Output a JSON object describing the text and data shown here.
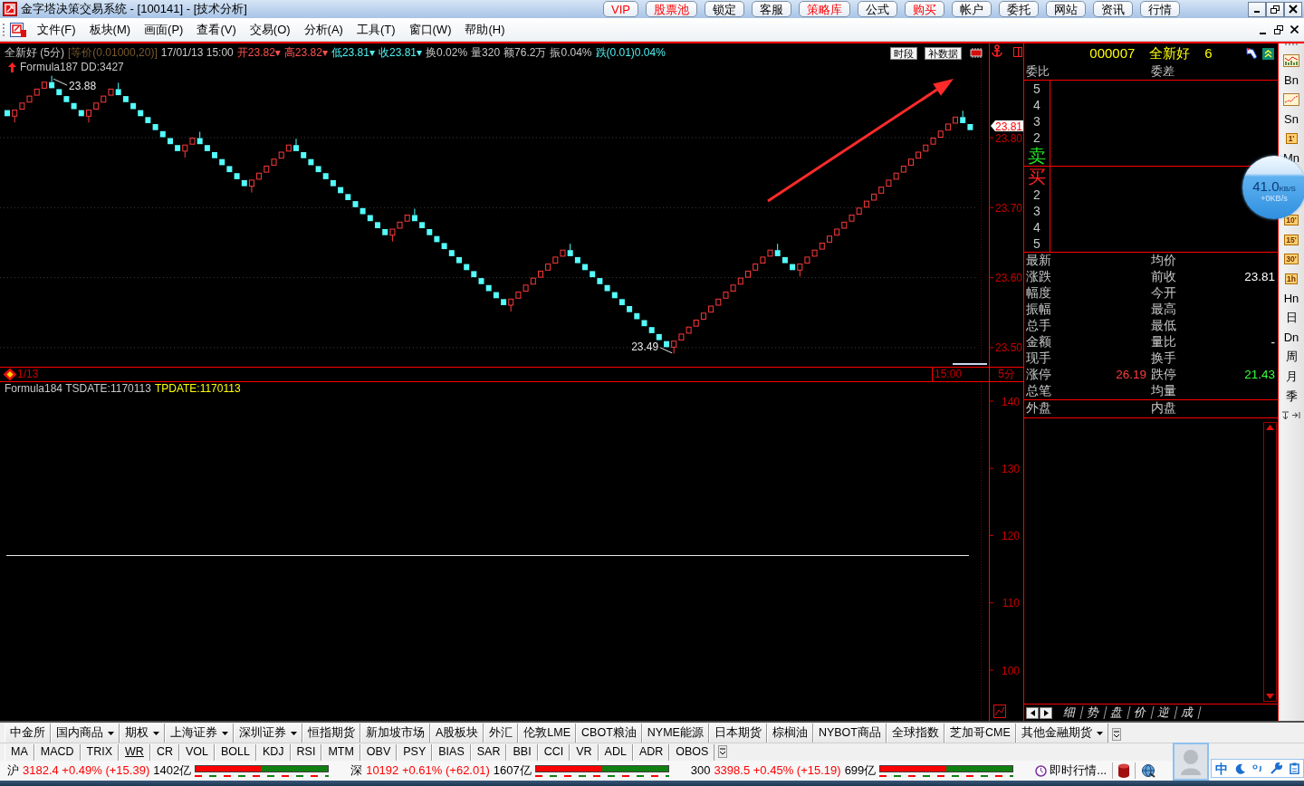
{
  "window": {
    "title": "金字塔决策交易系统 - [100141] - [技术分析]",
    "quick_buttons": [
      {
        "label": "VIP",
        "highlighted": true
      },
      {
        "label": "股票池",
        "highlighted": true
      },
      {
        "label": "锁定",
        "highlighted": false
      },
      {
        "label": "客服",
        "highlighted": false
      },
      {
        "label": "策略库",
        "highlighted": true
      },
      {
        "label": "公式",
        "highlighted": false
      },
      {
        "label": "购买",
        "highlighted": true
      },
      {
        "label": "帐户",
        "highlighted": false
      },
      {
        "label": "委托",
        "highlighted": false
      },
      {
        "label": "网站",
        "highlighted": false
      },
      {
        "label": "资讯",
        "highlighted": false
      },
      {
        "label": "行情",
        "highlighted": false
      }
    ]
  },
  "menu": [
    "文件(F)",
    "板块(M)",
    "画面(P)",
    "查看(V)",
    "交易(O)",
    "分析(A)",
    "工具(T)",
    "窗口(W)",
    "帮助(H)"
  ],
  "chart": {
    "header": [
      {
        "text": "全新好 (5分)",
        "color": "#c8c8c8"
      },
      {
        "text": "[等价(0.01000,20)]",
        "color": "#7a5a30"
      },
      {
        "text": "17/01/13 15:00",
        "color": "#c8c8c8"
      },
      {
        "text": "开23.82▾",
        "color": "#ff5050"
      },
      {
        "text": "高23.82▾",
        "color": "#ff5050"
      },
      {
        "text": "低23.81▾",
        "color": "#50f0f0"
      },
      {
        "text": "收23.81▾",
        "color": "#50f0f0"
      },
      {
        "text": "换0.02%",
        "color": "#c8c8c8"
      },
      {
        "text": "量320",
        "color": "#c8c8c8"
      },
      {
        "text": "额76.2万",
        "color": "#c8c8c8"
      },
      {
        "text": "振0.04%",
        "color": "#c8c8c8"
      },
      {
        "text": "跌(0.01)0.04%",
        "color": "#50f0f0"
      }
    ],
    "buttons": [
      "时段",
      "补数据"
    ],
    "formula": "Formula187 DD:3427",
    "high_label": "23.88",
    "low_label": "23.49",
    "last_price": "23.81",
    "yticks": [
      "23.80",
      "23.70",
      "23.60",
      "23.50"
    ],
    "date_label": "1/13",
    "time_label": "15:00",
    "period": "5分"
  },
  "indicator": {
    "formula": [
      {
        "text": "Formula184 TSDATE:1170113",
        "color": "#c8c8c8"
      },
      {
        "text": "TPDATE:1170113",
        "color": "#ffff00"
      }
    ],
    "yticks": [
      "140",
      "130",
      "120",
      "110",
      "100"
    ]
  },
  "quote": {
    "title": [
      "000007",
      "全新好",
      "6"
    ],
    "order_header": [
      "委比",
      "委差"
    ],
    "sell_levels": [
      "5",
      "4",
      "3",
      "2"
    ],
    "sell_label": "卖",
    "buy_label": "买",
    "buy_levels": [
      "2",
      "3",
      "4",
      "5"
    ],
    "stats": [
      [
        {
          "label": "最新"
        },
        {
          "label": "均价"
        }
      ],
      [
        {
          "label": "涨跌"
        },
        {
          "label": "前收",
          "value": "23.81"
        }
      ],
      [
        {
          "label": "幅度"
        },
        {
          "label": "今开"
        }
      ],
      [
        {
          "label": "振幅"
        },
        {
          "label": "最高"
        }
      ],
      [
        {
          "label": "总手"
        },
        {
          "label": "最低"
        }
      ],
      [
        {
          "label": "金额"
        },
        {
          "label": "量比",
          "value": "-"
        }
      ],
      [
        {
          "label": "现手"
        },
        {
          "label": "换手"
        }
      ],
      [
        {
          "label": "涨停",
          "value": "26.19",
          "color": "#ff3c3c"
        },
        {
          "label": "跌停",
          "value": "21.43",
          "color": "#3cff3c"
        }
      ],
      [
        {
          "label": "总笔"
        },
        {
          "label": "均量"
        }
      ]
    ],
    "trade_side": [
      "外盘",
      "内盘"
    ],
    "tabs": [
      "细",
      "势",
      "盘",
      "价",
      "逆",
      "成"
    ]
  },
  "period_bar": {
    "upper": [
      {
        "kind": "barchart"
      },
      {
        "kind": "text",
        "label": "Bn"
      },
      {
        "kind": "linechart"
      },
      {
        "kind": "text",
        "label": "Sn"
      },
      {
        "kind": "tile",
        "label": "1'"
      },
      {
        "kind": "text",
        "label": "Mn"
      }
    ],
    "lower": [
      {
        "kind": "tile",
        "label": "10'"
      },
      {
        "kind": "tile",
        "label": "15'"
      },
      {
        "kind": "tile",
        "label": "30'"
      },
      {
        "kind": "tile",
        "label": "1h"
      },
      {
        "kind": "text",
        "label": "Hn"
      },
      {
        "kind": "text",
        "label": "日"
      },
      {
        "kind": "text",
        "label": "Dn"
      },
      {
        "kind": "text",
        "label": "周"
      },
      {
        "kind": "text",
        "label": "月"
      },
      {
        "kind": "text",
        "label": "季"
      }
    ]
  },
  "speed_meter": {
    "value": "41.0",
    "unit": "KB/S",
    "delta": "+0KB/s"
  },
  "market_tabs": [
    {
      "label": "中金所",
      "dropdown": false
    },
    {
      "label": "国内商品",
      "dropdown": true
    },
    {
      "label": "期权",
      "dropdown": true
    },
    {
      "label": "上海证券",
      "dropdown": true
    },
    {
      "label": "深圳证券",
      "dropdown": true
    },
    {
      "label": "恒指期货",
      "dropdown": false
    },
    {
      "label": "新加坡市场",
      "dropdown": false
    },
    {
      "label": "A股板块",
      "dropdown": false
    },
    {
      "label": "外汇",
      "dropdown": false
    },
    {
      "label": "伦敦LME",
      "dropdown": false
    },
    {
      "label": "CBOT粮油",
      "dropdown": false
    },
    {
      "label": "NYME能源",
      "dropdown": false
    },
    {
      "label": "日本期货",
      "dropdown": false
    },
    {
      "label": "棕榈油",
      "dropdown": false
    },
    {
      "label": "NYBOT商品",
      "dropdown": false
    },
    {
      "label": "全球指数",
      "dropdown": false
    },
    {
      "label": "芝加哥CME",
      "dropdown": false
    },
    {
      "label": "其他金融期货",
      "dropdown": true
    }
  ],
  "indicator_tabs": [
    {
      "label": "MA",
      "selected": false
    },
    {
      "label": "MACD",
      "selected": false
    },
    {
      "label": "TRIX",
      "selected": false
    },
    {
      "label": "WR",
      "selected": true
    },
    {
      "label": "CR",
      "selected": false
    },
    {
      "label": "VOL",
      "selected": false
    },
    {
      "label": "BOLL",
      "selected": false
    },
    {
      "label": "KDJ",
      "selected": false
    },
    {
      "label": "RSI",
      "selected": false
    },
    {
      "label": "MTM",
      "selected": false
    },
    {
      "label": "OBV",
      "selected": false
    },
    {
      "label": "PSY",
      "selected": false
    },
    {
      "label": "BIAS",
      "selected": false
    },
    {
      "label": "SAR",
      "selected": false
    },
    {
      "label": "BBI",
      "selected": false
    },
    {
      "label": "CCI",
      "selected": false
    },
    {
      "label": "VR",
      "selected": false
    },
    {
      "label": "ADL",
      "selected": false
    },
    {
      "label": "ADR",
      "selected": false
    },
    {
      "label": "OBOS",
      "selected": false
    }
  ],
  "status_bar": {
    "indices": [
      {
        "market": "沪",
        "quote": "3182.4 +0.49% (+15.39)",
        "amount": "1402亿",
        "level": 0.49
      },
      {
        "market": "深",
        "quote": "10192 +0.61% (+62.01)",
        "amount": "1607亿",
        "level": 0.5
      },
      {
        "market": "300",
        "quote": "3398.5 +0.45% (+15.19)",
        "amount": "699亿",
        "level": 0.5
      }
    ],
    "feed": "即时行情..."
  },
  "ime": {
    "mode": "中"
  }
}
